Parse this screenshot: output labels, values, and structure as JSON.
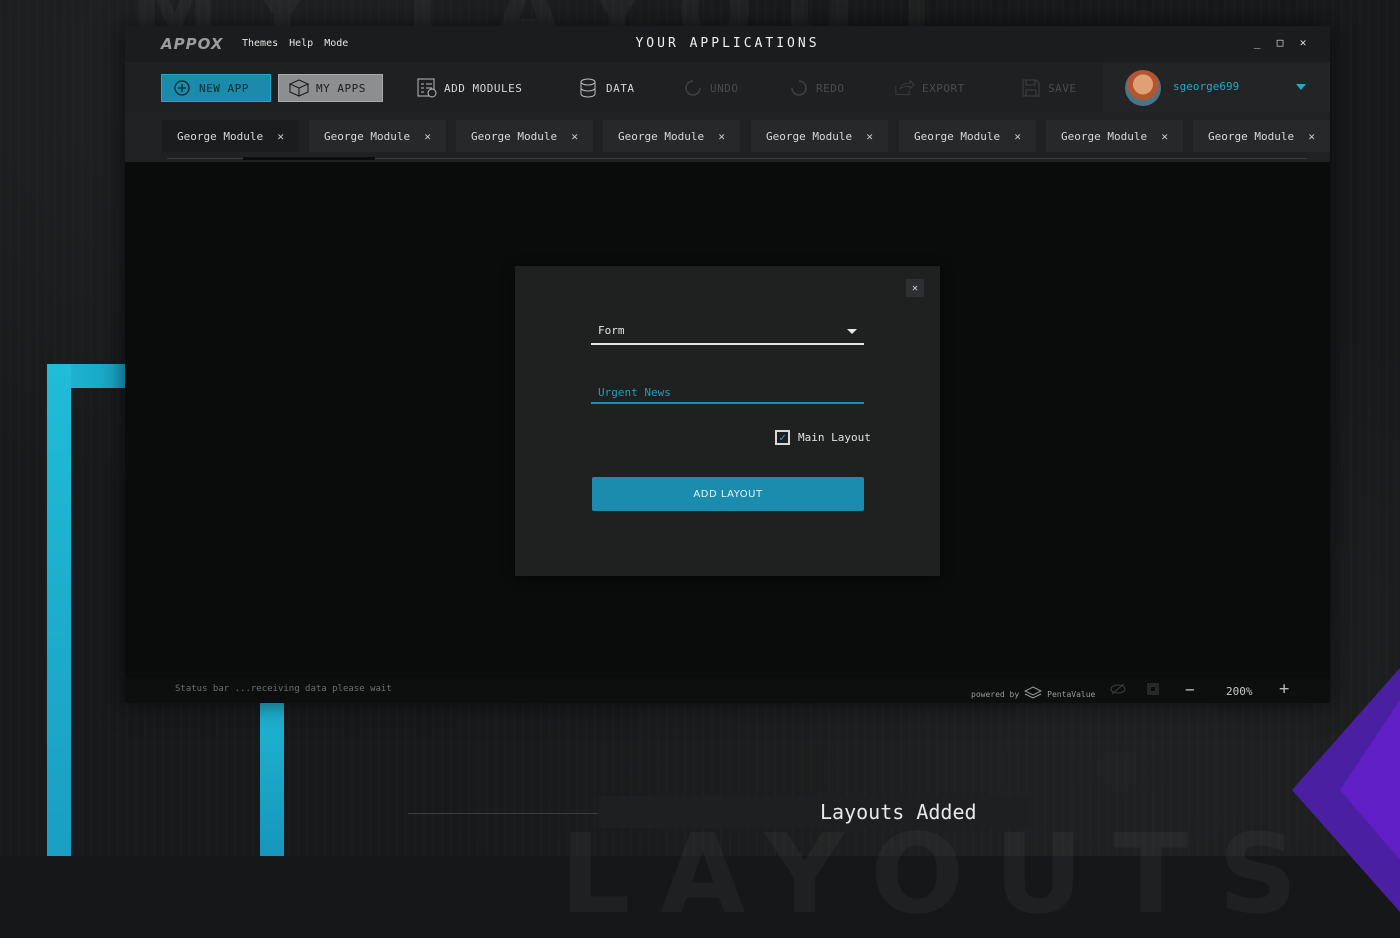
{
  "app": {
    "logo": "APPOX",
    "window_title": "YOUR APPLICATIONS",
    "menu": [
      "Themes",
      "Help",
      "Mode"
    ]
  },
  "window_controls": {
    "minimize": "_",
    "maximize": "□",
    "close": "✕"
  },
  "toolbar": {
    "new_app": "NEW APP",
    "my_apps": "MY APPS",
    "add_modules": "ADD MODULES",
    "data": "DATA",
    "undo": "UNDO",
    "redo": "REDO",
    "export": "EXPORT",
    "save": "SAVE"
  },
  "user": {
    "username": "sgeorge699"
  },
  "tabs": [
    {
      "label": "George Module"
    },
    {
      "label": "George Module"
    },
    {
      "label": "George Module"
    },
    {
      "label": "George Module"
    },
    {
      "label": "George Module"
    },
    {
      "label": "George Module"
    },
    {
      "label": "George Module"
    },
    {
      "label": "George Module"
    }
  ],
  "tab_close_glyph": "✕",
  "modal": {
    "close_glyph": "✕",
    "select_value": "Form",
    "input_value": "Urgent News",
    "checkbox_label": "Main Layout",
    "checkbox_checked": true,
    "checkbox_glyph": "✓",
    "button_label": "ADD LAYOUT"
  },
  "status": {
    "text": "Status bar ...receiving data please wait",
    "powered_by": "powered by",
    "brand": "PentaValue",
    "zoom_level": "200%",
    "zoom_minus": "−",
    "zoom_plus": "+"
  },
  "background": {
    "caption": "Layouts Added",
    "big_text_top": "MY LAYOUT",
    "big_text_bottom": "LAYOUTS"
  },
  "colors": {
    "accent": "#1b8cad",
    "accent_text": "#27a7c9",
    "window_bg": "#0a0b0b",
    "purple": "#4b1fa2"
  }
}
